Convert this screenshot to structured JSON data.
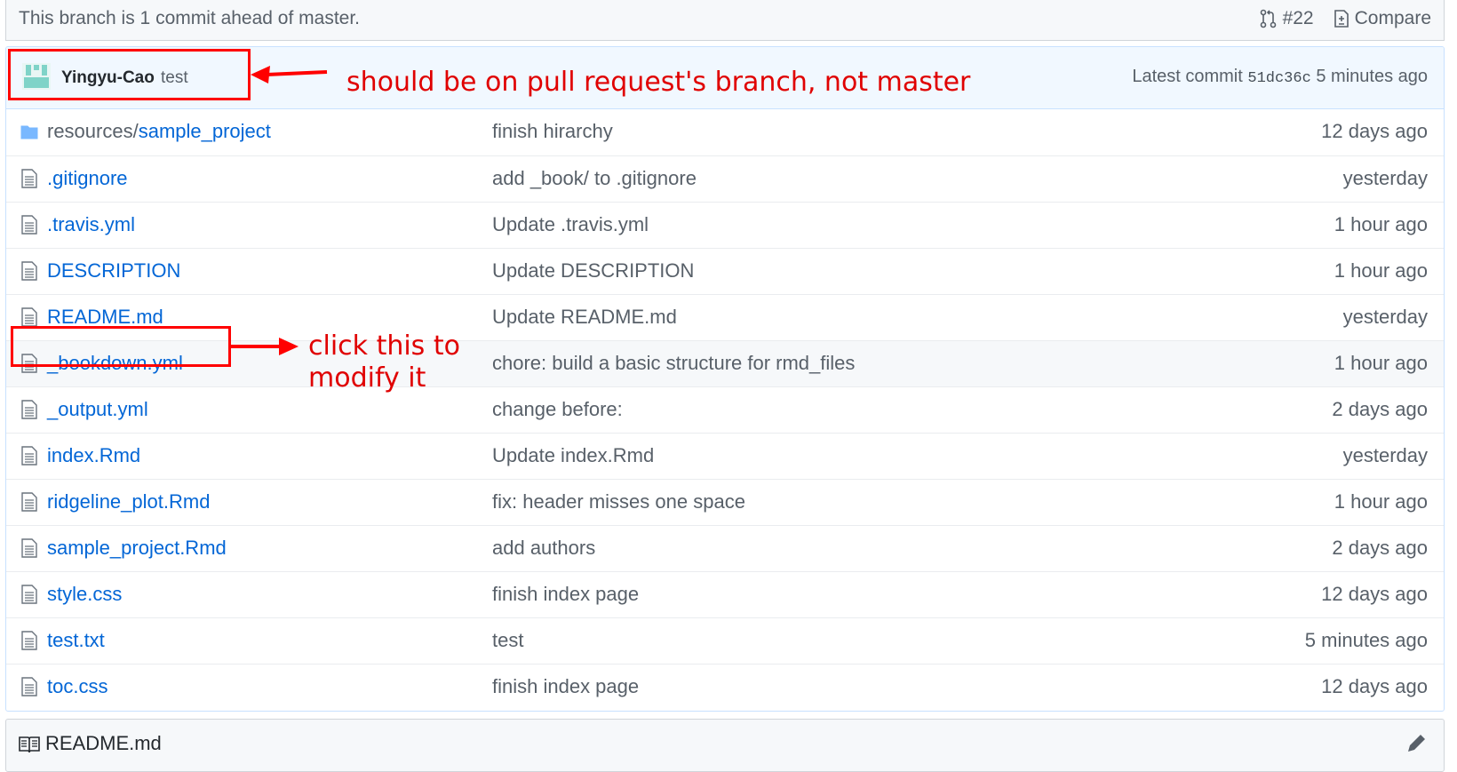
{
  "branch_bar": {
    "status_text": "This branch is 1 commit ahead of master.",
    "pr_label": "#22",
    "compare_label": "Compare"
  },
  "commit": {
    "author": "Yingyu-Cao",
    "message": "test",
    "latest_prefix": "Latest commit",
    "sha": "51dc36c",
    "time": "5 minutes ago"
  },
  "files": [
    {
      "dir": "resources/",
      "name": "sample_project",
      "message": "finish hirarchy",
      "age": "12 days ago",
      "type": "folder"
    },
    {
      "dir": "",
      "name": ".gitignore",
      "message": "add _book/ to .gitignore",
      "age": "yesterday",
      "type": "file"
    },
    {
      "dir": "",
      "name": ".travis.yml",
      "message": "Update .travis.yml",
      "age": "1 hour ago",
      "type": "file"
    },
    {
      "dir": "",
      "name": "DESCRIPTION",
      "message": "Update DESCRIPTION",
      "age": "1 hour ago",
      "type": "file"
    },
    {
      "dir": "",
      "name": "README.md",
      "message": "Update README.md",
      "age": "yesterday",
      "type": "file"
    },
    {
      "dir": "",
      "name": "_bookdown.yml",
      "message": "chore: build a basic structure for rmd_files",
      "age": "1 hour ago",
      "type": "file"
    },
    {
      "dir": "",
      "name": "_output.yml",
      "message": "change before:",
      "age": "2 days ago",
      "type": "file"
    },
    {
      "dir": "",
      "name": "index.Rmd",
      "message": "Update index.Rmd",
      "age": "yesterday",
      "type": "file"
    },
    {
      "dir": "",
      "name": "ridgeline_plot.Rmd",
      "message": "fix: header misses one space",
      "age": "1 hour ago",
      "type": "file"
    },
    {
      "dir": "",
      "name": "sample_project.Rmd",
      "message": "add authors",
      "age": "2 days ago",
      "type": "file"
    },
    {
      "dir": "",
      "name": "style.css",
      "message": "finish index page",
      "age": "12 days ago",
      "type": "file"
    },
    {
      "dir": "",
      "name": "test.txt",
      "message": "test",
      "age": "5 minutes ago",
      "type": "file"
    },
    {
      "dir": "",
      "name": "toc.css",
      "message": "finish index page",
      "age": "12 days ago",
      "type": "file"
    }
  ],
  "readme": {
    "title": "README.md"
  },
  "annotations": {
    "top": "should be on pull request's branch, not master",
    "middle_line1": "click this to",
    "middle_line2": "modify it",
    "color": "#ff0000"
  },
  "colors": {
    "link": "#0366d6",
    "muted": "#586069",
    "commit_bar_bg": "#f1f8ff"
  }
}
